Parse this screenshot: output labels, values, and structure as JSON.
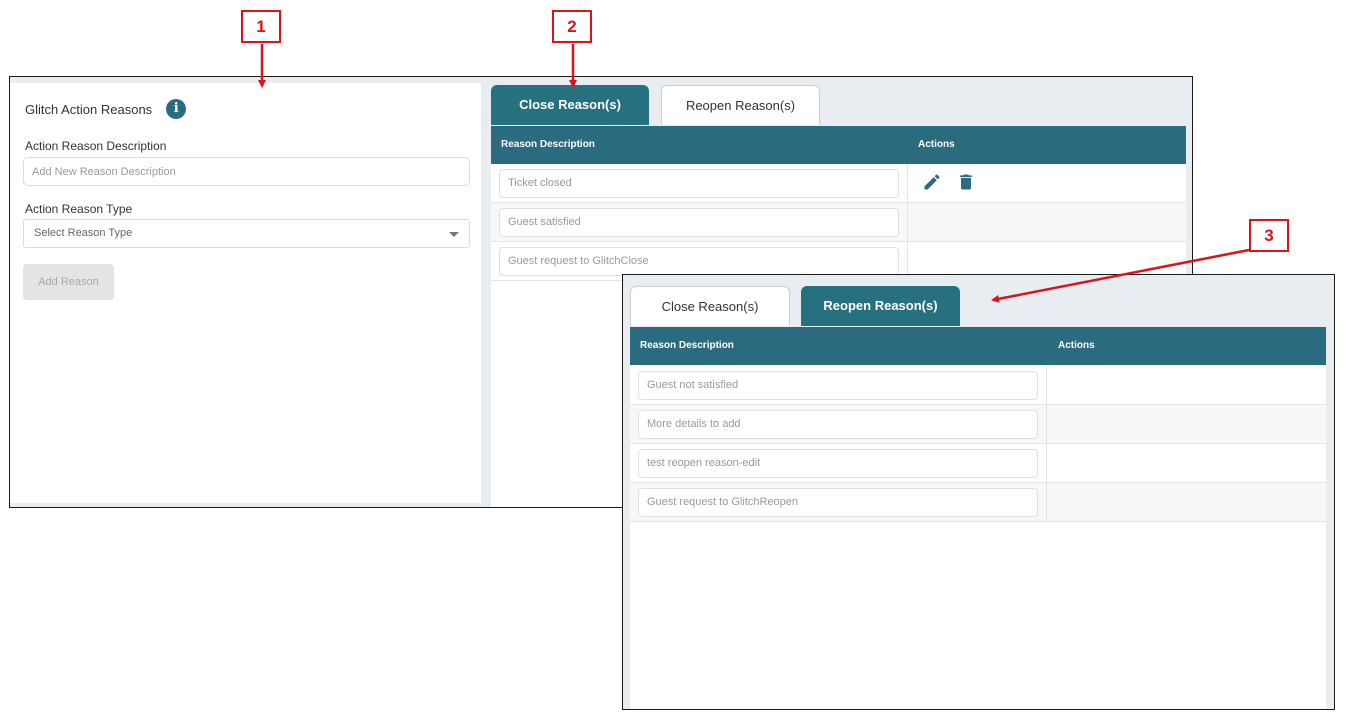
{
  "form": {
    "title": "Glitch Action Reasons",
    "info_icon": "info-icon",
    "description_label": "Action Reason Description",
    "description_placeholder": "Add New Reason Description",
    "type_label": "Action Reason Type",
    "type_selected": "Select Reason Type",
    "add_button": "Add Reason"
  },
  "tabs": {
    "close": "Close Reason(s)",
    "reopen": "Reopen Reason(s)"
  },
  "table": {
    "col_description": "Reason Description",
    "col_actions": "Actions"
  },
  "close_reasons": [
    "Ticket closed",
    "Guest satisfied",
    "Guest request to GlitchClose"
  ],
  "reopen_reasons": [
    "Guest not satisfied",
    "More details to add",
    "test reopen reason-edit",
    "Guest request to GlitchReopen"
  ],
  "icons": {
    "edit": "pencil-icon",
    "delete": "trash-icon"
  },
  "callouts": {
    "c1": "1",
    "c2": "2",
    "c3": "3"
  },
  "colors": {
    "accent": "#2a6b80",
    "callout": "#d9141b"
  }
}
